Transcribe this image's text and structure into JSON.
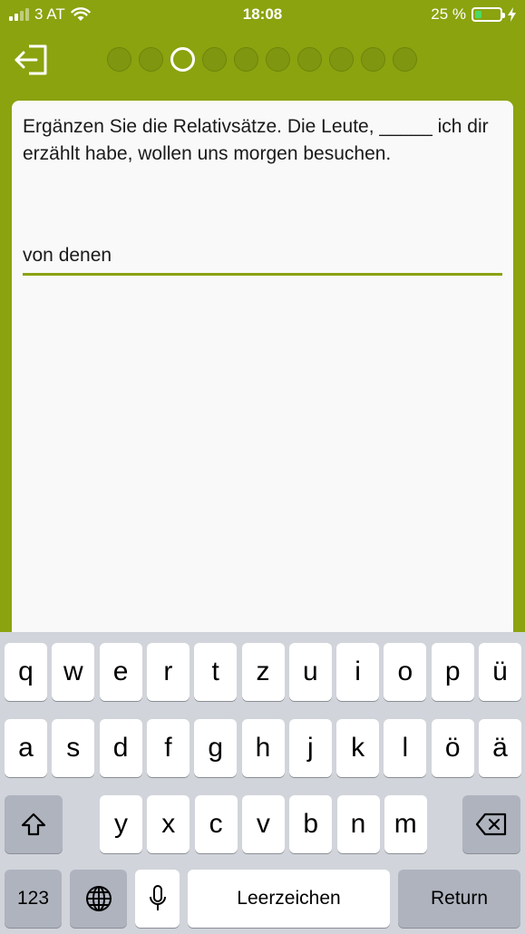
{
  "status_bar": {
    "carrier": "3 AT",
    "time": "18:08",
    "battery_percent": "25 %",
    "battery_level": 0.25
  },
  "header": {
    "exit_icon": "exit-arrow-icon",
    "progress": {
      "total": 10,
      "current": 3
    }
  },
  "question": {
    "text": "Ergänzen Sie die Relativsätze.  Die Leute, _____ ich dir erzählt habe, wollen uns morgen besuchen."
  },
  "answer": {
    "value": "von denen"
  },
  "keyboard": {
    "row1": [
      "q",
      "w",
      "e",
      "r",
      "t",
      "z",
      "u",
      "i",
      "o",
      "p",
      "ü"
    ],
    "row2": [
      "a",
      "s",
      "d",
      "f",
      "g",
      "h",
      "j",
      "k",
      "l",
      "ö",
      "ä"
    ],
    "row3": [
      "y",
      "x",
      "c",
      "v",
      "b",
      "n",
      "m"
    ],
    "numbers_label": "123",
    "space_label": "Leerzeichen",
    "return_label": "Return",
    "icons": [
      "shift-icon",
      "backspace-icon",
      "globe-icon",
      "microphone-icon"
    ]
  },
  "colors": {
    "accent": "#8aa30f",
    "card": "#f9f9f9",
    "keyboard_bg": "#d1d4da"
  }
}
